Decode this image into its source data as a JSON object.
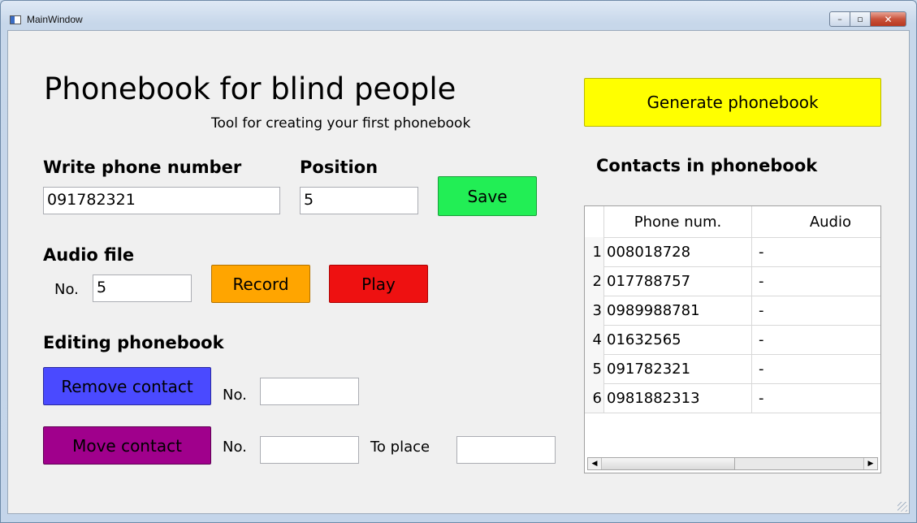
{
  "window": {
    "title": "MainWindow",
    "minimize_glyph": "–",
    "maximize_glyph": "▫",
    "close_glyph": "✕"
  },
  "header": {
    "title": "Phonebook for blind people",
    "subtitle": "Tool for creating your first phonebook"
  },
  "generate_button": {
    "label": "Generate phonebook",
    "color": "#ffff00"
  },
  "phone_entry": {
    "label": "Write phone number",
    "value": "091782321",
    "position_label": "Position",
    "position_value": "5",
    "save_label": "Save",
    "save_color": "#22ee55"
  },
  "audio": {
    "label": "Audio file",
    "no_label": "No.",
    "no_value": "5",
    "record_label": "Record",
    "record_color": "#ffa500",
    "play_label": "Play",
    "play_color": "#ee1111"
  },
  "editing": {
    "label": "Editing phonebook",
    "remove_label": "Remove contact",
    "remove_color": "#4a4aff",
    "remove_no_label": "No.",
    "remove_no_value": "",
    "move_label": "Move contact",
    "move_color": "#a0008c",
    "move_no_label": "No.",
    "move_no_value": "",
    "to_place_label": "To place",
    "to_place_value": ""
  },
  "contacts": {
    "heading": "Contacts in phonebook",
    "columns": [
      "Phone num.",
      "Audio"
    ],
    "rows": [
      {
        "num": "1",
        "phone": "008018728",
        "audio": "-"
      },
      {
        "num": "2",
        "phone": "017788757",
        "audio": "-"
      },
      {
        "num": "3",
        "phone": "0989988781",
        "audio": "-"
      },
      {
        "num": "4",
        "phone": "01632565",
        "audio": "-"
      },
      {
        "num": "5",
        "phone": "091782321",
        "audio": "-"
      },
      {
        "num": "6",
        "phone": "0981882313",
        "audio": "-"
      }
    ],
    "scroll_left_glyph": "◀",
    "scroll_right_glyph": "▶"
  }
}
